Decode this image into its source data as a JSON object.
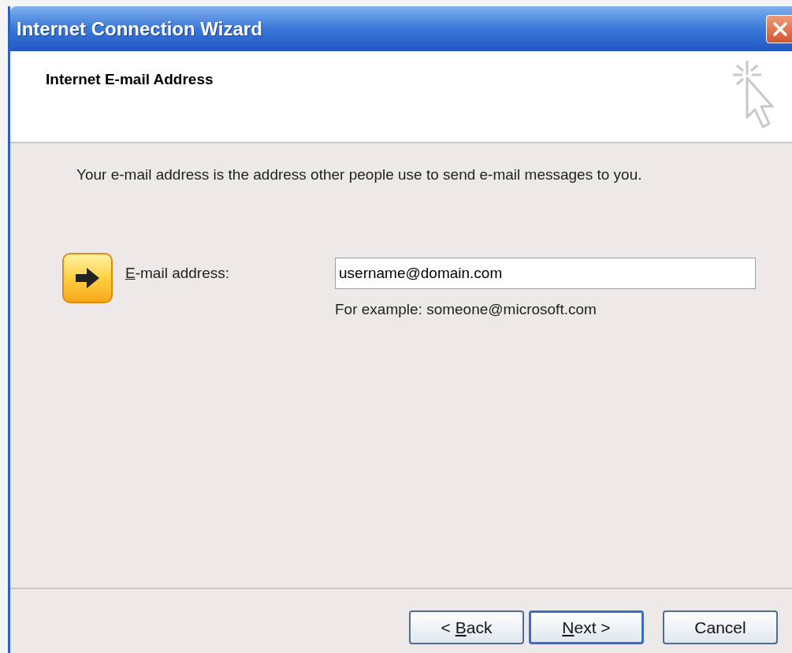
{
  "window": {
    "title": "Internet Connection Wizard"
  },
  "header": {
    "title": "Internet E-mail Address"
  },
  "intro": "Your e-mail address is the address other people use to send e-mail messages to you.",
  "email_field": {
    "label": {
      "mnemonic": "E",
      "rest": "-mail address:"
    },
    "value": "username@domain.com",
    "hint": "For example: someone@microsoft.com"
  },
  "buttons": [
    {
      "prefix": "< ",
      "mnemonic": "B",
      "rest": "ack",
      "default": false
    },
    {
      "mnemonic": "N",
      "rest": "ext >",
      "default": true
    },
    {
      "rest": "Cancel",
      "default": false
    }
  ]
}
